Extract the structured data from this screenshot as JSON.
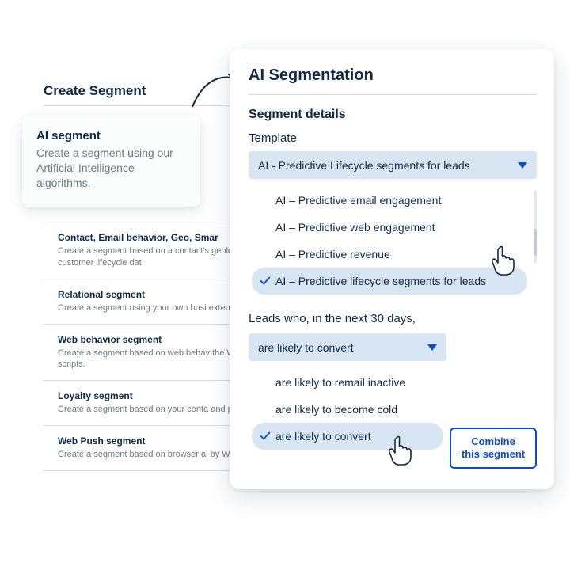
{
  "left": {
    "title": "Create Segment"
  },
  "callout": {
    "title": "AI segment",
    "desc": "Create a segment using our Artificial Intelligence algorithms."
  },
  "seg_list": [
    {
      "title": "Contact, Email behavior, Geo, Smar",
      "desc": "Create a segment based on a contact's\ngeolocation and customer lifecycle dat"
    },
    {
      "title": "Relational segment",
      "desc": "Create a segment using your own busi\nexternal databases."
    },
    {
      "title": "Web behavior segment",
      "desc": "Create a segment based on web behav\nthe Web Extend scripts."
    },
    {
      "title": "Loyalty segment",
      "desc": "Create a segment based on your conta\nand points."
    },
    {
      "title": "Web Push segment",
      "desc": "Create a segment based on browser ai\nby Web Push."
    }
  ],
  "panel": {
    "title": "AI Segmentation",
    "sub": "Segment details",
    "template_label": "Template",
    "template_selected": "AI - Predictive Lifecycle segments for leads",
    "template_options": [
      "AI – Predictive email engagement",
      "AI – Predictive web engagement",
      "AI – Predictive revenue",
      "AI – Predictive lifecycle segments for leads"
    ],
    "template_selected_index": 3,
    "leads_text": "Leads who, in the next 30 days,",
    "leads_selected": "are likely to convert",
    "leads_options": [
      "are likely to remail inactive",
      "are likely to become cold",
      "are likely to convert"
    ],
    "leads_selected_index": 2,
    "combine_label": "Combine this segment"
  }
}
